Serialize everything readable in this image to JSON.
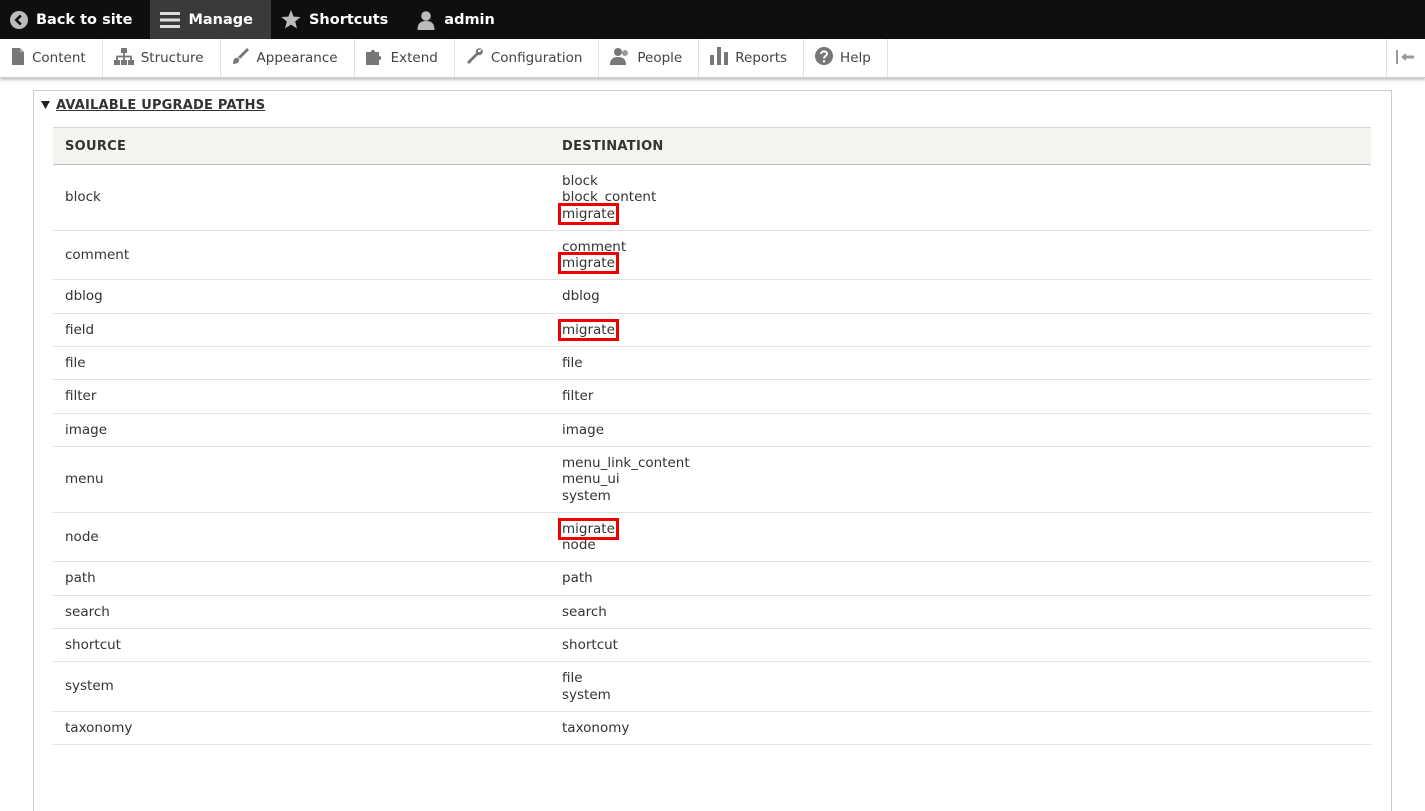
{
  "toolbar": {
    "back": "Back to site",
    "manage": "Manage",
    "shortcuts": "Shortcuts",
    "user": "admin"
  },
  "tray": {
    "items": [
      "Content",
      "Structure",
      "Appearance",
      "Extend",
      "Configuration",
      "People",
      "Reports",
      "Help"
    ]
  },
  "details": {
    "summary": "AVAILABLE UPGRADE PATHS",
    "col_source": "SOURCE",
    "col_destination": "DESTINATION"
  },
  "rows": [
    {
      "source": "block",
      "destinations": [
        "block",
        "block_content",
        "migrate"
      ],
      "highlighted": [
        "migrate"
      ]
    },
    {
      "source": "comment",
      "destinations": [
        "comment",
        "migrate"
      ],
      "highlighted": [
        "migrate"
      ]
    },
    {
      "source": "dblog",
      "destinations": [
        "dblog"
      ],
      "highlighted": []
    },
    {
      "source": "field",
      "destinations": [
        "migrate"
      ],
      "highlighted": [
        "migrate"
      ]
    },
    {
      "source": "file",
      "destinations": [
        "file"
      ],
      "highlighted": []
    },
    {
      "source": "filter",
      "destinations": [
        "filter"
      ],
      "highlighted": []
    },
    {
      "source": "image",
      "destinations": [
        "image"
      ],
      "highlighted": []
    },
    {
      "source": "menu",
      "destinations": [
        "menu_link_content",
        "menu_ui",
        "system"
      ],
      "highlighted": []
    },
    {
      "source": "node",
      "destinations": [
        "migrate",
        "node"
      ],
      "highlighted": [
        "migrate"
      ]
    },
    {
      "source": "path",
      "destinations": [
        "path"
      ],
      "highlighted": []
    },
    {
      "source": "search",
      "destinations": [
        "search"
      ],
      "highlighted": []
    },
    {
      "source": "shortcut",
      "destinations": [
        "shortcut"
      ],
      "highlighted": []
    },
    {
      "source": "system",
      "destinations": [
        "file",
        "system"
      ],
      "highlighted": []
    },
    {
      "source": "taxonomy",
      "destinations": [
        "taxonomy"
      ],
      "highlighted": []
    }
  ],
  "colors": {
    "toolbar_bg": "#0f0f0f",
    "highlight": "#e00000"
  }
}
